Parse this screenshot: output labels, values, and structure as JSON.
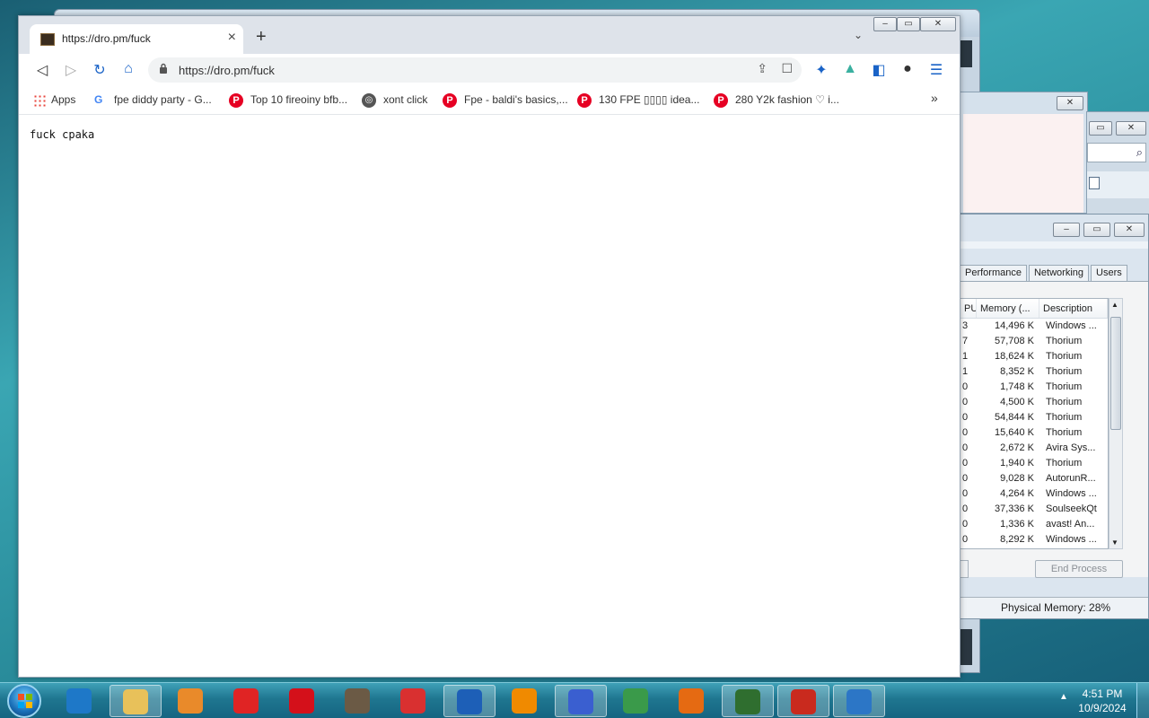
{
  "browser": {
    "tab_title": "https://dro.pm/fuck",
    "url": "https://dro.pm/fuck",
    "page_text": "fuck cpaka",
    "bookmarks": [
      {
        "label": "Apps",
        "icon": "apps-grid-icon"
      },
      {
        "label": "fpe diddy party - G...",
        "icon": "google-icon"
      },
      {
        "label": "Top 10 fireoiny bfb...",
        "icon": "pinterest-icon"
      },
      {
        "label": "xont click",
        "icon": "globe-icon"
      },
      {
        "label": "Fpe - baldi's basics,...",
        "icon": "pinterest-icon"
      },
      {
        "label": "130 FPE ▯▯▯▯ idea...",
        "icon": "pinterest-icon"
      },
      {
        "label": "280 Y2k fashion ♡ i...",
        "icon": "pinterest-icon"
      }
    ],
    "overflow": "»"
  },
  "task_manager": {
    "tabs": [
      "Performance",
      "Networking",
      "Users"
    ],
    "columns": [
      "PU",
      "Memory (...",
      "Description"
    ],
    "rows": [
      {
        "cpu": "3",
        "mem": "14,496 K",
        "desc": "Windows ..."
      },
      {
        "cpu": "7",
        "mem": "57,708 K",
        "desc": "Thorium"
      },
      {
        "cpu": "1",
        "mem": "18,624 K",
        "desc": "Thorium"
      },
      {
        "cpu": "1",
        "mem": "8,352 K",
        "desc": "Thorium"
      },
      {
        "cpu": "0",
        "mem": "1,748 K",
        "desc": "Thorium"
      },
      {
        "cpu": "0",
        "mem": "4,500 K",
        "desc": "Thorium"
      },
      {
        "cpu": "0",
        "mem": "54,844 K",
        "desc": "Thorium"
      },
      {
        "cpu": "0",
        "mem": "15,640 K",
        "desc": "Thorium"
      },
      {
        "cpu": "0",
        "mem": "2,672 K",
        "desc": "Avira Sys..."
      },
      {
        "cpu": "0",
        "mem": "1,940 K",
        "desc": "Thorium"
      },
      {
        "cpu": "0",
        "mem": "9,028 K",
        "desc": "AutorunR..."
      },
      {
        "cpu": "0",
        "mem": "4,264 K",
        "desc": "Windows ..."
      },
      {
        "cpu": "0",
        "mem": "37,336 K",
        "desc": "SoulseekQt"
      },
      {
        "cpu": "0",
        "mem": "1,336 K",
        "desc": "avast! An..."
      },
      {
        "cpu": "0",
        "mem": "8,292 K",
        "desc": "Windows ..."
      }
    ],
    "end_process": "End Process",
    "physical_memory": "Physical Memory: 28%"
  },
  "taskbar": {
    "apps": [
      {
        "name": "internet-explorer-icon",
        "color": "#1e78c8",
        "active": false
      },
      {
        "name": "file-explorer-icon",
        "color": "#e8c15a",
        "active": true
      },
      {
        "name": "media-player-icon",
        "color": "#e98a2a",
        "active": false
      },
      {
        "name": "roblox-icon",
        "color": "#e02424",
        "active": false
      },
      {
        "name": "opera-icon",
        "color": "#d4101a",
        "active": false
      },
      {
        "name": "gimp-icon",
        "color": "#6b5a45",
        "active": false
      },
      {
        "name": "roblox-studio-icon",
        "color": "#d93030",
        "active": false
      },
      {
        "name": "thorium-icon",
        "color": "#1d5fb7",
        "active": true
      },
      {
        "name": "vlc-icon",
        "color": "#f08a00",
        "active": false
      },
      {
        "name": "bird-app-icon",
        "color": "#3a5fd0",
        "active": true
      },
      {
        "name": "messenger-icon",
        "color": "#3a9a4a",
        "active": false
      },
      {
        "name": "firefox-icon",
        "color": "#e56a12",
        "active": false
      },
      {
        "name": "task-manager-icon",
        "color": "#2f6e2f",
        "active": true
      },
      {
        "name": "angry-bird-icon",
        "color": "#c92a1e",
        "active": true
      },
      {
        "name": "network-globe-icon",
        "color": "#2c76c6",
        "active": true
      }
    ],
    "time": "4:51 PM",
    "date": "10/9/2024",
    "tray_arrow": "▲"
  }
}
